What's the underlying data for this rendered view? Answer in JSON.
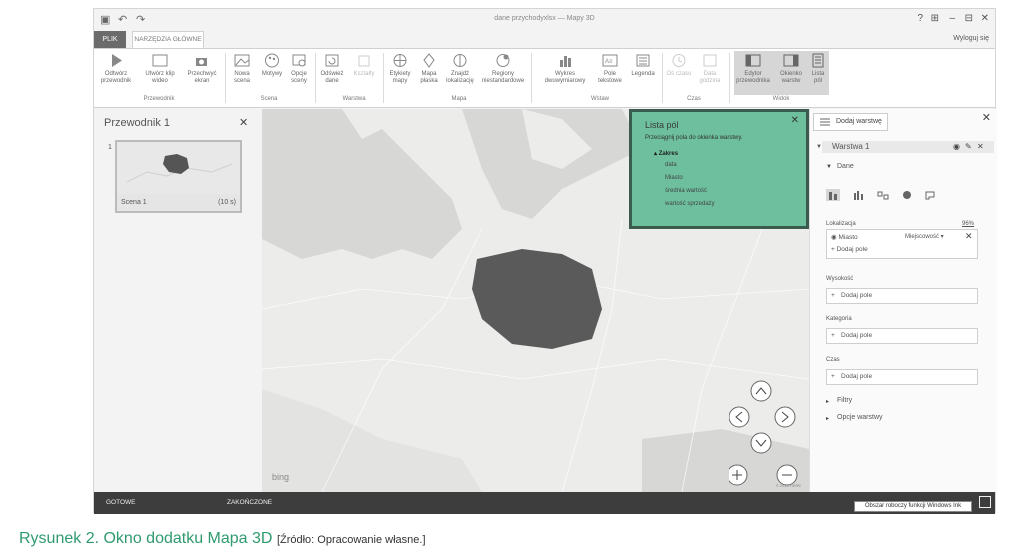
{
  "window": {
    "title": "dane przychodyxlsx — Mapy 3D",
    "sign_out": "Wyloguj się"
  },
  "title_bar_controls": [
    "?",
    "⊞",
    "–",
    "⊟",
    "✕"
  ],
  "tabs": {
    "file": "PLIK",
    "home": "NARZĘDZIA GŁÓWNE"
  },
  "ribbon": {
    "buttons": {
      "play_tour": "Odtwórz przewodnik",
      "create_video": "Utwórz klip wideo",
      "capture_screen": "Przechwyć ekran",
      "new_scene": "Nowa scena",
      "themes": "Motywy",
      "scene_options": "Opcje sceny",
      "refresh_data": "Odśwież dane",
      "shapes": "Kształty",
      "map_labels": "Etykiety mapy",
      "flat_map": "Mapa płaska",
      "find_location": "Znajdź lokalizację",
      "custom_regions": "Regiony niestandardowe",
      "2d_chart": "Wykres dwuwymiarowy",
      "text_box": "Pole tekstowe",
      "legend": "Legenda",
      "time_line": "Oś czasu",
      "date_time": "Data godzina",
      "tour_editor": "Edytor przewodnika",
      "layer_pane": "Okienko warstw",
      "field_list": "Lista pól"
    },
    "groups": {
      "tour": "Przewodnik",
      "scene": "Scena",
      "layer": "Warstwa",
      "map": "Mapa",
      "insert": "Wstaw",
      "time": "Czas",
      "view": "Widok"
    }
  },
  "tour_panel": {
    "title": "Przewodnik 1",
    "scene_number": "1",
    "scene_name": "Scena 1",
    "scene_duration": "(10 s)"
  },
  "map": {
    "provider": "bing",
    "copyright": "© 2015 HERE"
  },
  "field_list": {
    "title": "Lista pól",
    "hint": "Przeciągnij pola do okienka warstwy.",
    "table": "Zakres",
    "fields": [
      "data",
      "Miasto",
      "średnia wartość",
      "wartość sprzedaży"
    ]
  },
  "layer_pane": {
    "add_layer": "Dodaj warstwę",
    "layer_name": "Warstwa 1",
    "data_section": "Dane",
    "location_label": "Lokalizacja",
    "location_confidence": "96%",
    "location_field": "Miasto",
    "location_type": "Miejscowość",
    "add_field": "Dodaj pole",
    "height_label": "Wysokość",
    "category_label": "Kategoria",
    "time_label": "Czas",
    "filters": "Filtry",
    "layer_options": "Opcje warstwy"
  },
  "status_bar": {
    "ready": "GOTOWE",
    "done": "ZAKOŃCZONE",
    "tooltip": "Obszar roboczy funkcji Windows Ink"
  },
  "caption": {
    "main": "Rysunek 2. Okno dodatku Mapa 3D",
    "source": "[Źródło: Opracowanie własne.]"
  },
  "colors": {
    "accent_green": "#2f9a6e",
    "field_list_bg": "#6dbf9e",
    "data_points": "#555555"
  }
}
